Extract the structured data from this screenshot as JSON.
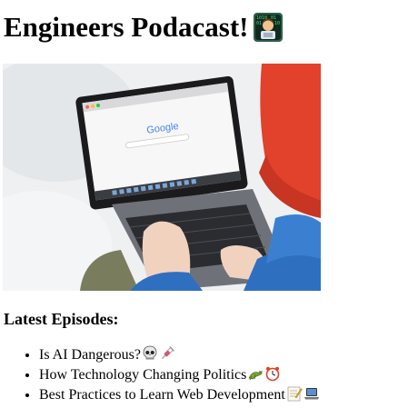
{
  "header": {
    "title": "Engineers Podacast!",
    "title_emoji_icon": "technologist-icon"
  },
  "hero": {
    "image_icon": "laptop-photo-icon",
    "screen_logo_text": "Google"
  },
  "latest": {
    "heading": "Latest Episodes:",
    "episodes": [
      {
        "title": "Is AI Dangerous?",
        "icons": [
          "skull-icon",
          "syringe-icon"
        ]
      },
      {
        "title": "How Technology Changing Politics",
        "icons": [
          "lizard-icon",
          "alarm-clock-icon"
        ]
      },
      {
        "title": "Best Practices to Learn Web Development",
        "icons": [
          "memo-icon",
          "laptop-icon"
        ]
      }
    ]
  },
  "colors": {
    "text": "#000000",
    "background": "#ffffff",
    "jacket_blue": "#2f6fbf",
    "hat_red": "#e2412c"
  }
}
